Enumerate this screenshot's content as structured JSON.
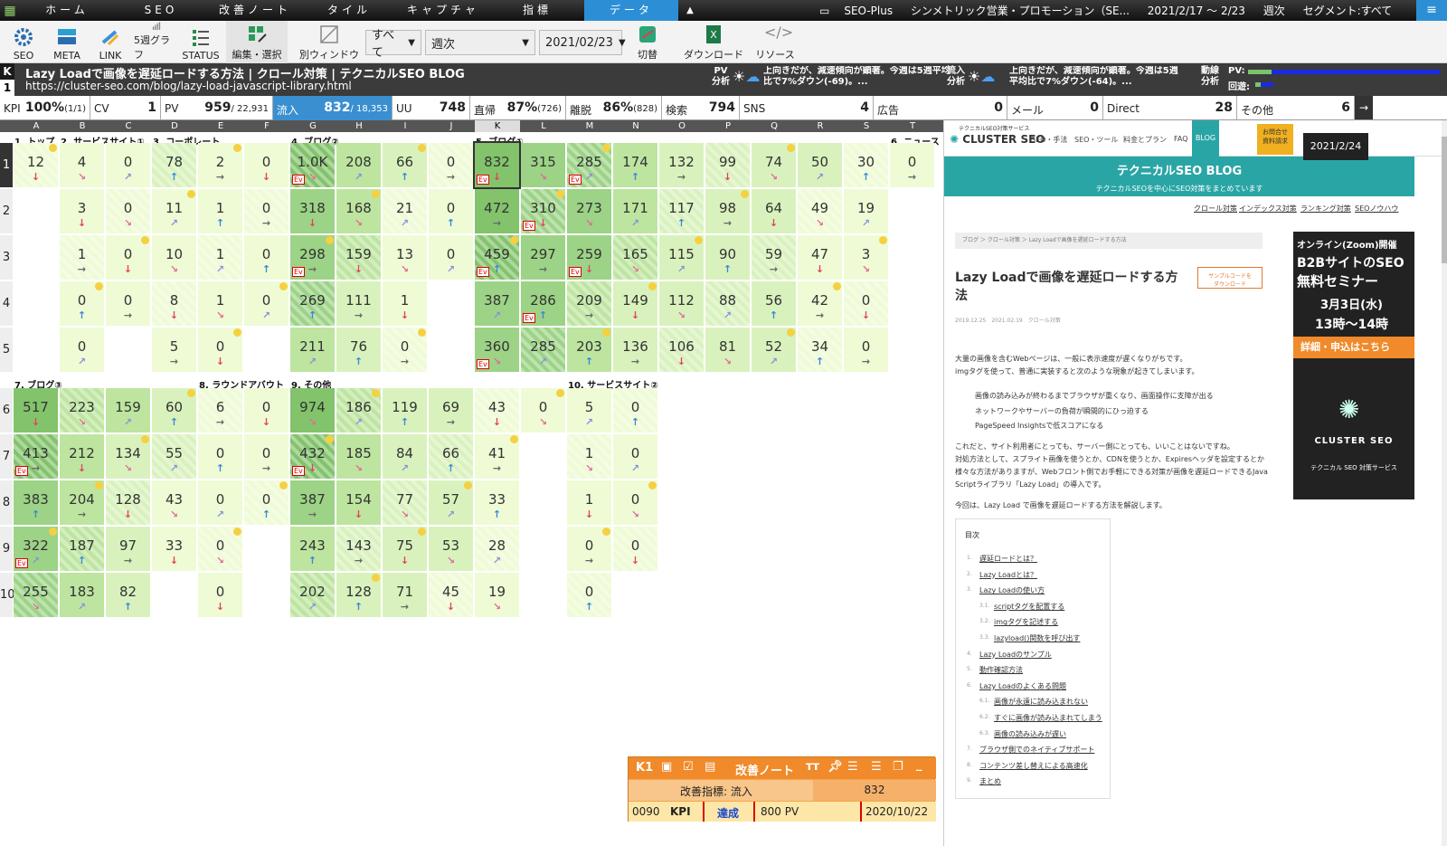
{
  "topnav": {
    "tabs": [
      "ホーム",
      "SEO",
      "改善ノート",
      "タイル",
      "キャプチャ",
      "指標",
      "データ"
    ],
    "active_tab": "データ",
    "site": "SEO-Plus",
    "company": "シンメトリック営業・プロモーション（SE...",
    "date_range": "2021/2/17 ～ 2/23",
    "period": "週次",
    "segment": "セグメント:すべて"
  },
  "toolbar": {
    "buttons": [
      "SEO",
      "META",
      "LINK",
      "5週グラフ",
      "STATUS"
    ],
    "edit_label": "編集・選択",
    "newwin_label": "別ウィンドウ",
    "filter_select": "すべて",
    "period_select": "週次",
    "date_select": "2021/02/23",
    "toggle_label": "切替",
    "download_label": "ダウンロード",
    "resource_label": "リソース"
  },
  "pagebar": {
    "k_label": "K",
    "row_label": "1",
    "title": "Lazy Loadで画像を遅延ロードする方法 | クロール対策 | テクニカルSEO BLOG",
    "url": "https://cluster-seo.com/blog/lazy-load-javascript-library.html",
    "pv_label": "PV\n分析",
    "pv_text": "上向きだが、減速傾向が顕著。今週は5週平均比で7%ダウン(-69)。...",
    "inflow_label": "流入\n分析",
    "inflow_text": "上向きだが、減速傾向が顕著。今週は5週平均比で7%ダウン(-64)。...",
    "dynamics_label": "動線\n分析",
    "pv_bar_label": "PV:",
    "return_bar_label": "回遊:"
  },
  "kpis": [
    {
      "label": "KPI",
      "value": "100%",
      "sub": "(1/1)"
    },
    {
      "label": "CV",
      "value": "1",
      "sub": ""
    },
    {
      "label": "PV",
      "value": "959",
      "sub": "/ 22,931"
    },
    {
      "label": "流入",
      "value": "832",
      "sub": "/ 18,353",
      "active": true
    },
    {
      "label": "UU",
      "value": "748",
      "sub": ""
    },
    {
      "label": "直帰",
      "value": "87%",
      "sub": "(726)"
    },
    {
      "label": "離脱",
      "value": "86%",
      "sub": "(828)"
    },
    {
      "label": "検索",
      "value": "794",
      "sub": ""
    },
    {
      "label": "SNS",
      "value": "4",
      "sub": ""
    },
    {
      "label": "広告",
      "value": "0",
      "sub": ""
    },
    {
      "label": "メール",
      "value": "0",
      "sub": ""
    },
    {
      "label": "Direct",
      "value": "28",
      "sub": ""
    },
    {
      "label": "その他",
      "value": "6",
      "sub": ""
    }
  ],
  "grid": {
    "columns": [
      "A",
      "B",
      "C",
      "D",
      "E",
      "F",
      "G",
      "H",
      "I",
      "J",
      "K",
      "L",
      "M",
      "N",
      "O",
      "P",
      "Q",
      "R",
      "S",
      "T"
    ],
    "selected_column": "K",
    "rows": [
      "1",
      "2",
      "3",
      "4",
      "5",
      "6",
      "7",
      "8",
      "9",
      "10"
    ],
    "selected_row": "1",
    "group_labels_top": [
      "1. トップ",
      "2. サービスサイト①",
      "3. コーポレート",
      "4. ブログ②",
      "5. ブログ①",
      "6. ニュース"
    ],
    "group_labels_mid": [
      "7. ブログ③",
      "8. ラウンドアバウト",
      "9. その他",
      "10. サービスサイト②"
    ],
    "cells": [
      [
        "12",
        "4",
        "0",
        "78",
        "2",
        "0",
        "1.0K",
        "208",
        "66",
        "0",
        "832",
        "315",
        "285",
        "174",
        "132",
        "99",
        "74",
        "50",
        "30",
        "0"
      ],
      [
        "",
        "3",
        "0",
        "11",
        "1",
        "0",
        "318",
        "168",
        "21",
        "0",
        "472",
        "310",
        "273",
        "171",
        "117",
        "98",
        "64",
        "49",
        "19",
        ""
      ],
      [
        "",
        "1",
        "0",
        "10",
        "1",
        "0",
        "298",
        "159",
        "13",
        "0",
        "459",
        "297",
        "259",
        "165",
        "115",
        "90",
        "59",
        "47",
        "3",
        ""
      ],
      [
        "",
        "0",
        "0",
        "8",
        "1",
        "0",
        "269",
        "111",
        "1",
        "",
        "387",
        "286",
        "209",
        "149",
        "112",
        "88",
        "56",
        "42",
        "0",
        ""
      ],
      [
        "",
        "0",
        "",
        "5",
        "0",
        "",
        "211",
        "76",
        "0",
        "",
        "360",
        "285",
        "203",
        "136",
        "106",
        "81",
        "52",
        "34",
        "0",
        ""
      ],
      [
        "517",
        "223",
        "159",
        "60",
        "6",
        "0",
        "974",
        "186",
        "119",
        "69",
        "43",
        "0",
        "5",
        "0"
      ],
      [
        "413",
        "212",
        "134",
        "55",
        "0",
        "0",
        "432",
        "185",
        "84",
        "66",
        "41",
        "",
        "1",
        "0"
      ],
      [
        "383",
        "204",
        "128",
        "43",
        "0",
        "0",
        "387",
        "154",
        "77",
        "57",
        "33",
        "",
        "1",
        "0"
      ],
      [
        "322",
        "187",
        "97",
        "33",
        "0",
        "",
        "243",
        "143",
        "75",
        "53",
        "28",
        "",
        "0",
        "0"
      ],
      [
        "255",
        "183",
        "82",
        "",
        "0",
        "",
        "202",
        "128",
        "71",
        "45",
        "19",
        "",
        "0",
        ""
      ]
    ]
  },
  "preview": {
    "logo": "CLUSTER SEO",
    "logo_sub": "テクニカルSEO対策サービス",
    "nav": [
      "SEO・手法",
      "SEO・ツール",
      "料金とプラン",
      "FAQ",
      "BLOG"
    ],
    "contact": "お問合せ\n資料請求",
    "banner_title": "テクニカルSEO BLOG",
    "banner_sub": "テクニカルSEOを中心にSEO対策をまとめています",
    "date_tip": "2021/2/24",
    "subnav": [
      "クロール対策",
      "インデックス対策",
      "ランキング対策",
      "SEOノウハウ"
    ],
    "breadcrumb": "ブログ ＞ クロール対策 ＞ Lazy Loadで画像を遅延ロードする方法",
    "article_title": "Lazy Loadで画像を遅延ロードする方法",
    "sample_btn": "サンプルコードを\nダウンロード",
    "meta_dates": "2019.12.25　2021.02.19　クロール対策",
    "body": [
      "大量の画像を含むWebページは、一般に表示速度が遅くなりがちです。",
      "imgタグを使って、普通に実装すると次のような現象が起きてしまいます。",
      "画像の読み込みが終わるまでブラウザが重くなり、画面操作に支障が出る",
      "ネットワークやサーバーの負荷が瞬間的にひっ迫する",
      "PageSpeed Insightsで低スコアになる",
      "これだと、サイト利用者にとっても、サーバー側にとっても、いいことはないですね。",
      "対処方法として、スプライト画像を使うとか、CDNを使うとか、Expiresヘッダを設定するとか",
      "様々な方法がありますが、Webフロント側でお手軽にできる対策が画像を遅延ロードできるJava",
      "Scriptライブラリ「Lazy Load」の導入です。",
      "今回は、Lazy Load で画像を遅延ロードする方法を解説します。"
    ],
    "toc_title": "目次",
    "toc": [
      [
        "1.",
        "遅延ロードとは？"
      ],
      [
        "2.",
        "Lazy Loadとは？"
      ],
      [
        "3.",
        "Lazy Loadの使い方"
      ],
      [
        "3.1.",
        "scriptタグを配置する"
      ],
      [
        "3.2.",
        "imgタグを記述する"
      ],
      [
        "3.3.",
        "lazyload()関数を呼び出す"
      ],
      [
        "4.",
        "Lazy Loadのサンプル"
      ],
      [
        "5.",
        "動作確認方法"
      ],
      [
        "6.",
        "Lazy Loadのよくある問題"
      ],
      [
        "6.1.",
        "画像が永遠に読み込まれない"
      ],
      [
        "6.2.",
        "すぐに画像が読み込まれてしまう"
      ],
      [
        "6.3.",
        "画像の読み込みが遅い"
      ],
      [
        "7.",
        "ブラウザ側でのネイティブサポート"
      ],
      [
        "8.",
        "コンテンツ差し替えによる高速化"
      ],
      [
        "9.",
        "まとめ"
      ]
    ],
    "ad": {
      "l1": "オンライン(Zoom)開催",
      "l2": "B2BサイトのSEO",
      "l3": "無料セミナー",
      "date": "3月3日(水)",
      "time": "13時～14時",
      "cta": "詳細・申込はこちら",
      "brand": "CLUSTER SEO",
      "brand_sub": "テクニカル SEO 対策サービス"
    }
  },
  "note": {
    "id": "K1",
    "title": "改善ノート",
    "metric_label": "改善指標: 流入",
    "metric_value": "832",
    "code": "0090",
    "kpi": "KPI",
    "status": "達成",
    "target": "800 PV",
    "date": "2020/10/22"
  }
}
